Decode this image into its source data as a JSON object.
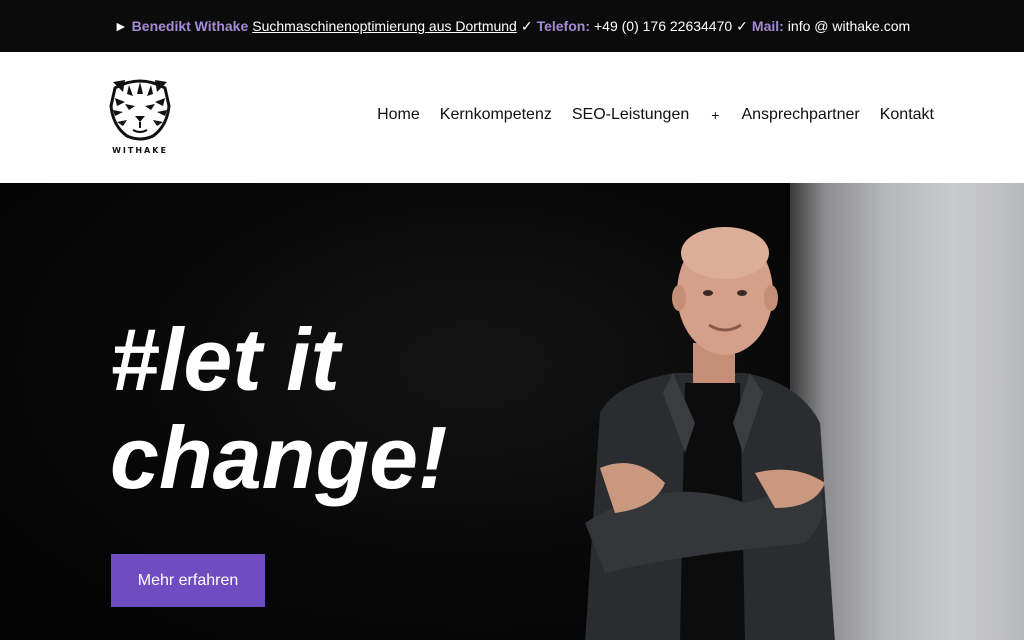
{
  "topbar": {
    "arrow": "►",
    "name": "Benedikt Withake",
    "tagline": "Suchmaschinenoptimierung aus Dortmund",
    "check1": "✓",
    "phone_label": "Telefon:",
    "phone": "+49 (0) 176 22634470",
    "check2": "✓",
    "mail_label": "Mail:",
    "mail": "info @ withake.com"
  },
  "header": {
    "logo_text": "WITHAKE",
    "nav": [
      "Home",
      "Kernkompetenz",
      "SEO-Leistungen",
      "+",
      "Ansprechpartner",
      "Kontakt"
    ]
  },
  "hero": {
    "headline_line1": "#let it",
    "headline_line2": "change!",
    "cta_label": "Mehr erfahren"
  },
  "colors": {
    "accent": "#6f4cc0",
    "topbar_accent": "#a58ad8",
    "topbar_bg": "#0b0b0b"
  }
}
